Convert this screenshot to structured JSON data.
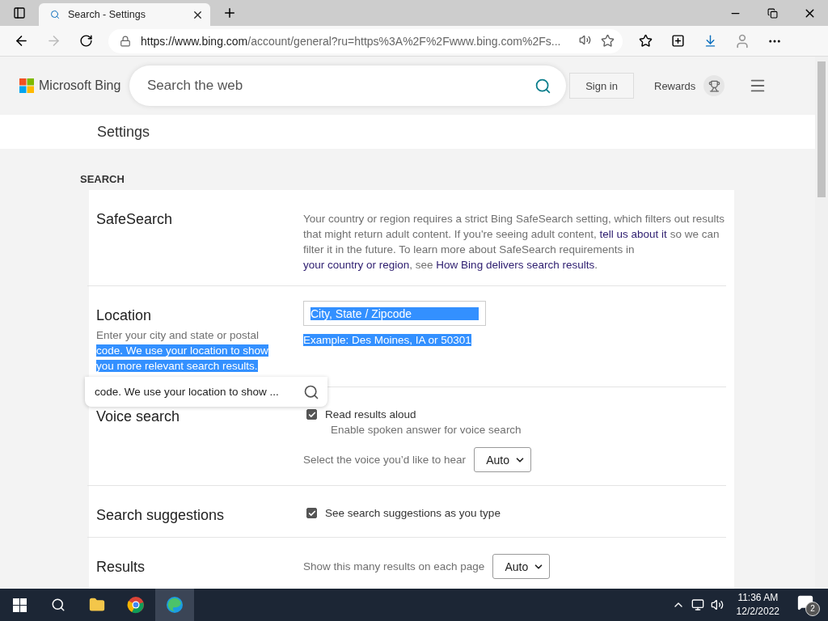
{
  "browser": {
    "tab_title": "Search - Settings",
    "url_host": "https://www.bing.com",
    "url_path": "/account/general?ru=https%3A%2F%2Fwww.bing.com%2Fs..."
  },
  "header": {
    "logo": "Microsoft Bing",
    "search": {
      "placeholder": "Search the web"
    },
    "sign_in": "Sign in",
    "rewards": "Rewards"
  },
  "settings_title": "Settings",
  "section": "SEARCH",
  "rows": [
    {
      "kind": "description",
      "label": "SafeSearch",
      "segments": [
        {
          "text": "Your country or region requires a strict Bing SafeSearch setting, which filters out results that might return adult content. If you're seeing adult content, ",
          "link": false
        },
        {
          "text": "tell us about it",
          "link": true
        },
        {
          "text": " so we can filter it in the future. To learn more about SafeSearch requirements in ",
          "link": false
        },
        {
          "text": "your country or region",
          "link": true
        },
        {
          "text": ", see ",
          "link": false
        },
        {
          "text": "How Bing delivers search results",
          "link": true
        },
        {
          "text": ".",
          "link": false
        }
      ]
    },
    {
      "kind": "location",
      "label": "Location",
      "description": [
        {
          "text": "Enter your city and state or postal",
          "highlighted": false
        },
        {
          "text": "code. We use your location to show you more relevant search results.",
          "highlighted": true
        }
      ],
      "field": {
        "placeholder": "City, State / Zipcode",
        "highlighted": true
      },
      "example": {
        "text": "Example: Des Moines, IA or 50301",
        "highlighted": true
      },
      "popup": "code. We use your location to show ..."
    },
    {
      "kind": "voice",
      "label": "Voice search",
      "checkbox": {
        "label": "Read results aloud",
        "checked": true
      },
      "note": "Enable spoken answer for voice search",
      "select_label": "Select the voice you’d like to hear",
      "select_value": "Auto"
    },
    {
      "kind": "checkbox",
      "label": "Search suggestions",
      "checkbox": {
        "label": "See search suggestions as you type",
        "checked": true
      }
    },
    {
      "kind": "select",
      "label": "Results",
      "select_label": "Show this many results on each page",
      "select_value": "Auto"
    }
  ],
  "taskbar": {
    "time": "11:36 AM",
    "date": "12/2/2022",
    "notifications": "2"
  }
}
